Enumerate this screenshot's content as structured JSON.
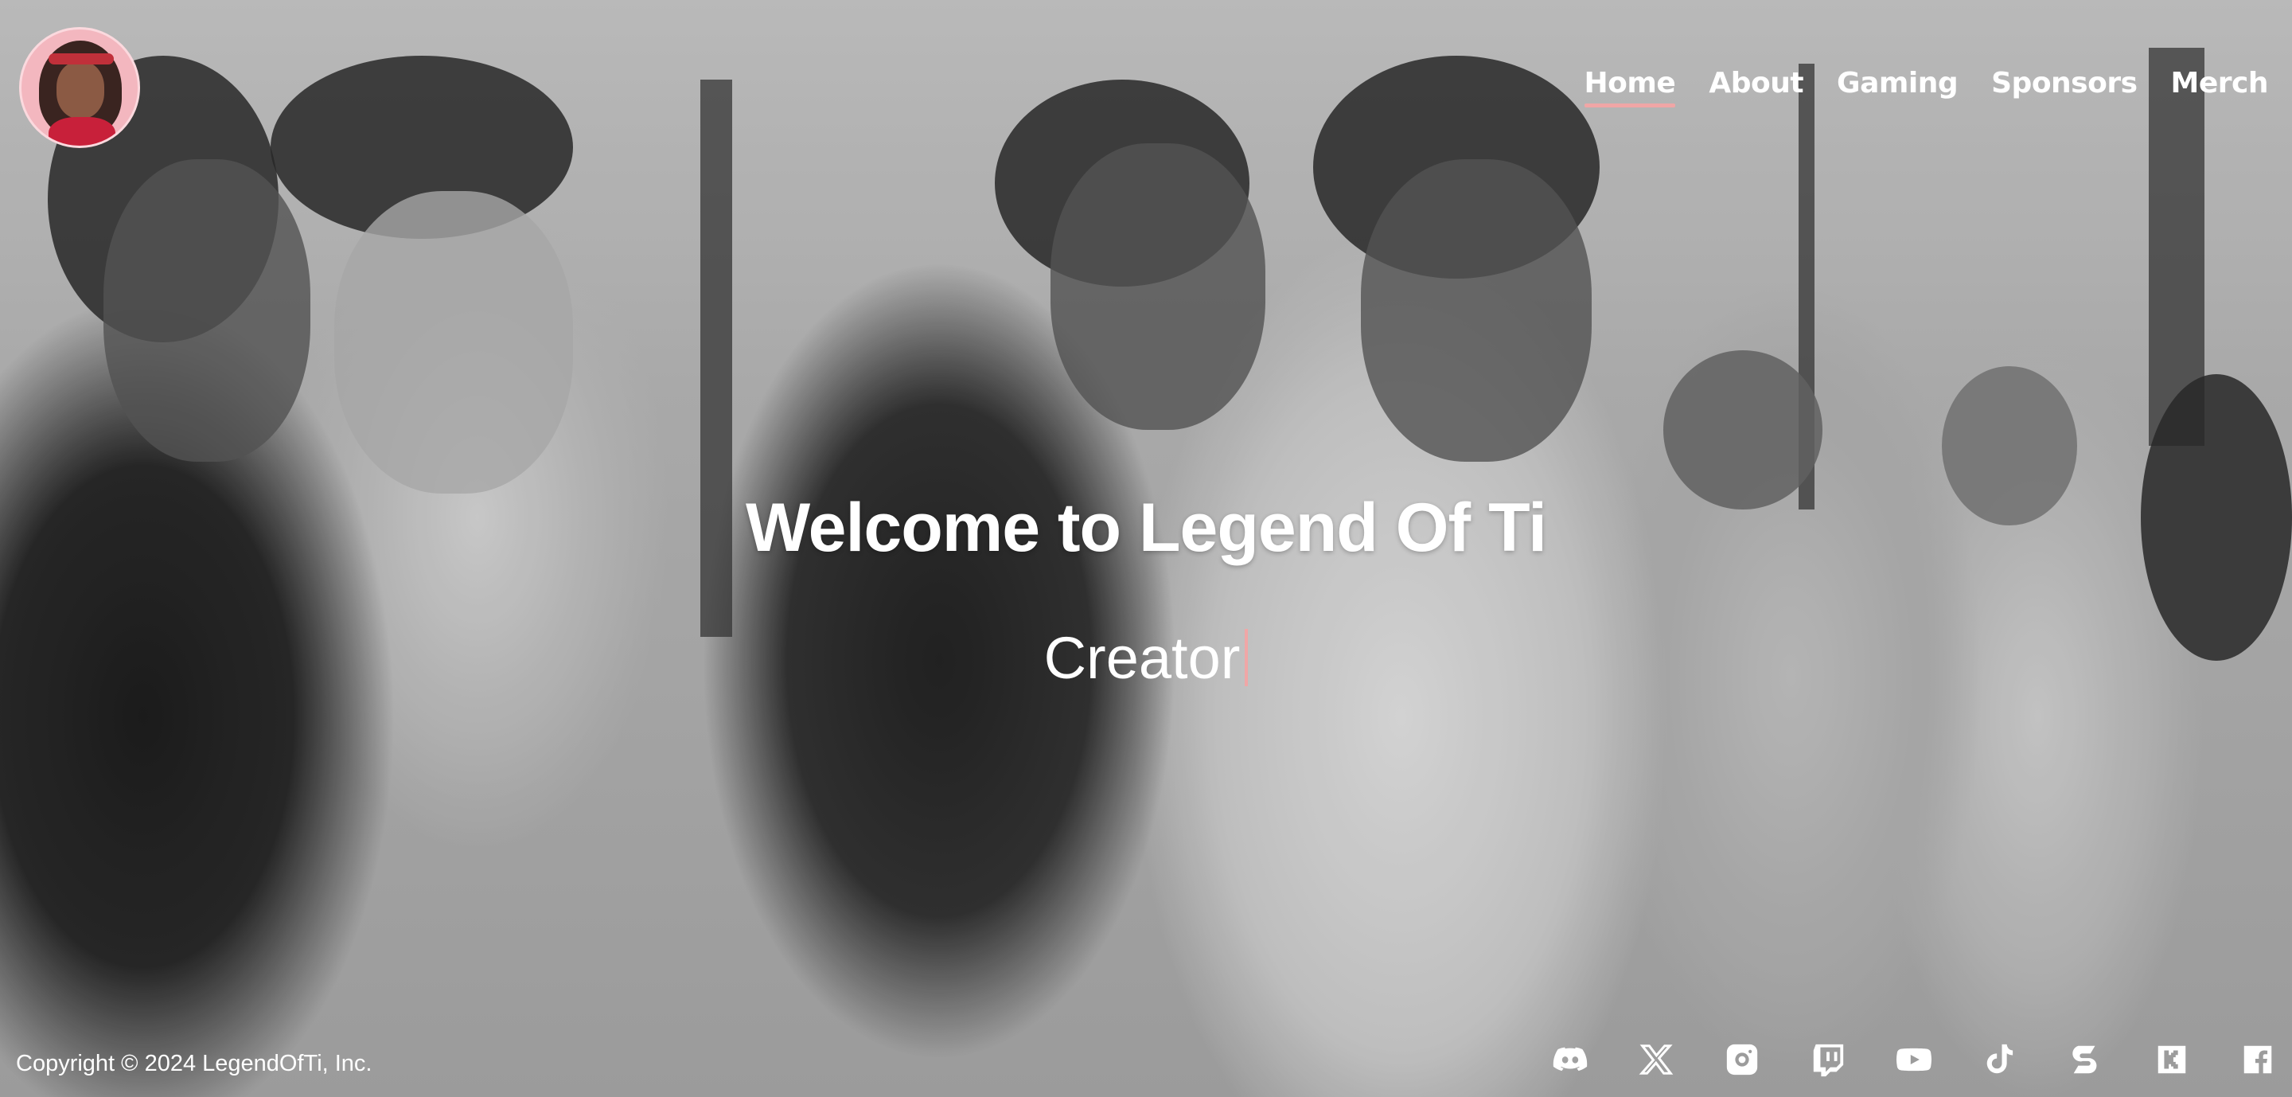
{
  "nav": {
    "items": [
      {
        "label": "Home",
        "active": true
      },
      {
        "label": "About",
        "active": false
      },
      {
        "label": "Gaming",
        "active": false
      },
      {
        "label": "Sponsors",
        "active": false
      },
      {
        "label": "Merch",
        "active": false
      }
    ]
  },
  "hero": {
    "title": "Welcome to Legend Of Ti",
    "subtitle": "Creator"
  },
  "footer": {
    "copyright": "Copyright © 2024 LegendOfTi, Inc.",
    "social_icons": [
      "discord-icon",
      "x-icon",
      "instagram-icon",
      "twitch-icon",
      "youtube-icon",
      "tiktok-icon",
      "streamlabs-icon",
      "kick-icon",
      "facebook-icon"
    ]
  },
  "colors": {
    "accent": "#f0a6a6",
    "text": "#ffffff"
  }
}
